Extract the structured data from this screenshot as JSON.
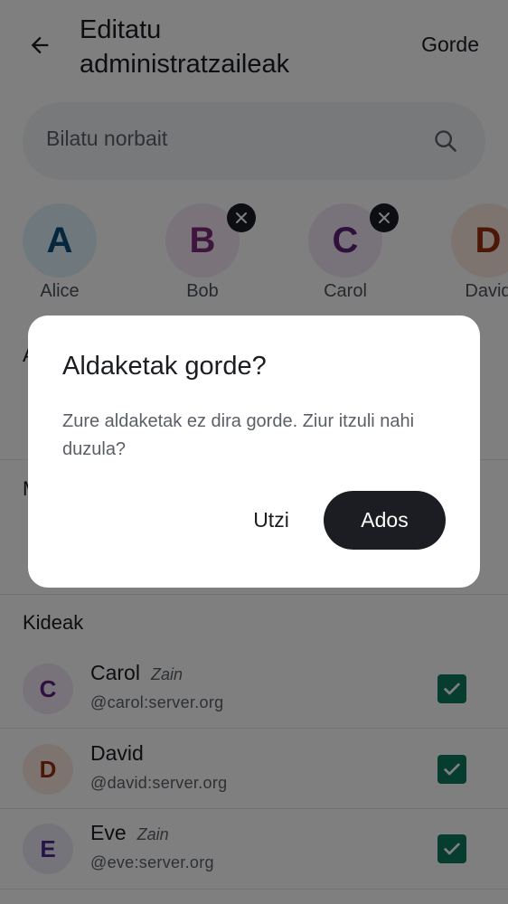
{
  "header": {
    "title": "Editatu administratzaileak",
    "save_label": "Gorde",
    "back_icon": "arrow-left-icon"
  },
  "search": {
    "placeholder": "Bilatu norbait",
    "icon": "search-icon"
  },
  "selected": [
    {
      "initial": "A",
      "name": "Alice",
      "removable": false,
      "bg": "#dff1f8",
      "fg": "#0b4d78"
    },
    {
      "initial": "B",
      "name": "Bob",
      "removable": true,
      "bg": "#f5e7f4",
      "fg": "#7d2a7a"
    },
    {
      "initial": "C",
      "name": "Carol",
      "removable": true,
      "bg": "#f1e6f6",
      "fg": "#5e1f79"
    },
    {
      "initial": "D",
      "name": "David",
      "removable": true,
      "bg": "#fbe9e1",
      "fg": "#9b2f10"
    }
  ],
  "sections": {
    "hidden_a": "A",
    "hidden_m": "M",
    "members": "Kideak"
  },
  "members": [
    {
      "initial": "C",
      "name": "Carol",
      "role": "Zain",
      "id": "@carol:server.org",
      "checked": true,
      "bg": "#f1e6f6",
      "fg": "#5e1f79"
    },
    {
      "initial": "D",
      "name": "David",
      "role": "",
      "id": "@david:server.org",
      "checked": true,
      "bg": "#fbe9e1",
      "fg": "#9b2f10"
    },
    {
      "initial": "E",
      "name": "Eve",
      "role": "Zain",
      "id": "@eve:server.org",
      "checked": true,
      "bg": "#ece8f7",
      "fg": "#4a2a8c"
    }
  ],
  "dialog": {
    "title": "Aldaketak gorde?",
    "body": "Zure aldaketak ez dira gorde. Ziur itzuli nahi duzula?",
    "cancel_label": "Utzi",
    "ok_label": "Ados"
  },
  "colors": {
    "accent_dark": "#1b1d22",
    "checkbox": "#0c7a5d",
    "scrim": "rgba(0,0,0,0.5)"
  }
}
